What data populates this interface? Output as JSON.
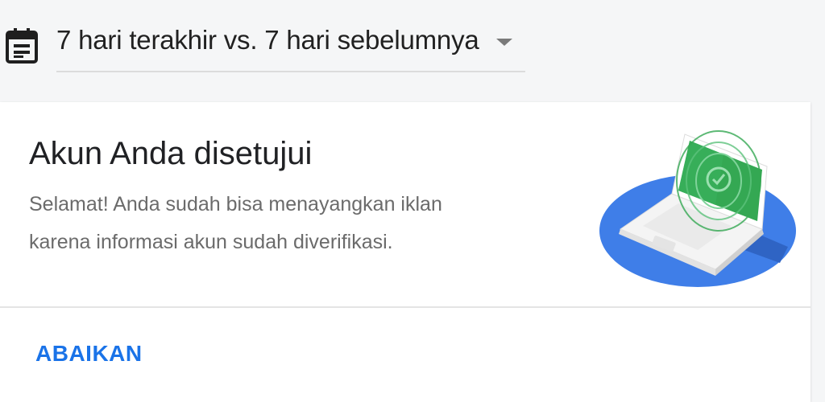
{
  "date_range": {
    "label": "7 hari terakhir vs. 7 hari sebelumnya",
    "icon": "calendar-icon",
    "dropdown_icon": "caret-down-icon"
  },
  "card": {
    "title": "Akun Anda disetujui",
    "body_lines": [
      "Selamat! Anda sudah bisa menayangkan iklan",
      "karena informasi akun sudah diverifikasi."
    ],
    "illustration": "laptop-verified-illustration",
    "dismiss_label": "ABAIKAN"
  },
  "colors": {
    "accent": "#1a73e8",
    "illustration_blue": "#3f7ee8",
    "illustration_green": "#34a853",
    "page_background": "#f5f6f7"
  }
}
